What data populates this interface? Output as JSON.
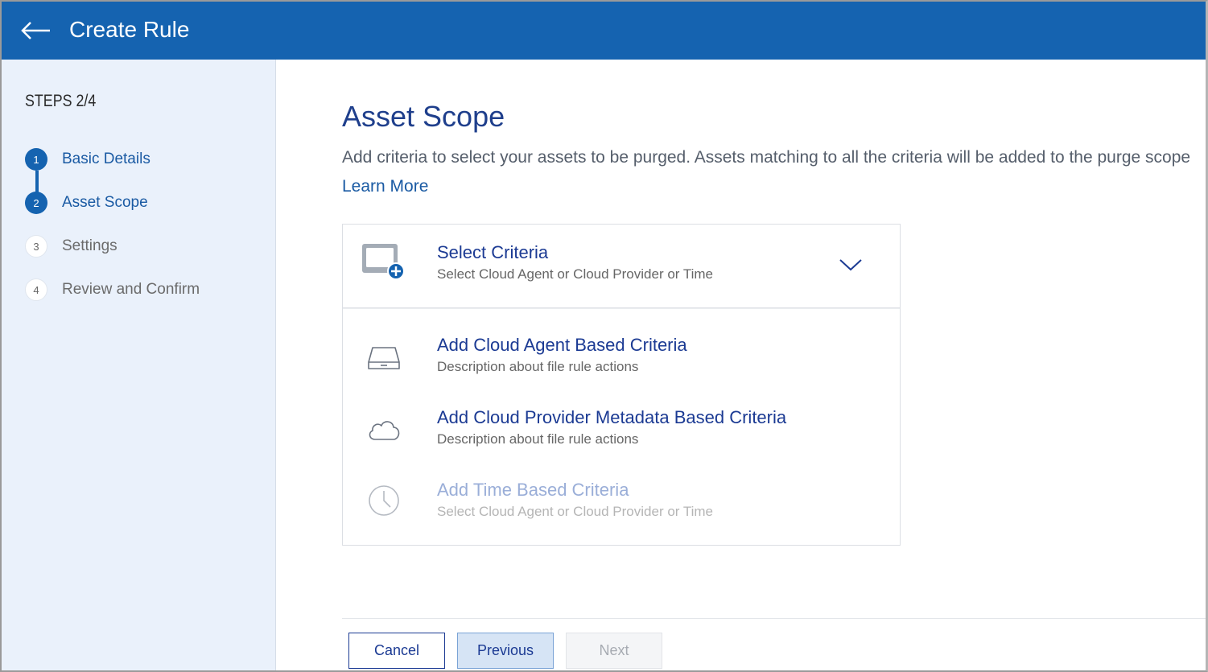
{
  "header": {
    "title": "Create Rule"
  },
  "sidebar": {
    "steps_label": "STEPS 2/4",
    "items": [
      {
        "number": "1",
        "label": "Basic Details",
        "state": "done"
      },
      {
        "number": "2",
        "label": "Asset Scope",
        "state": "active"
      },
      {
        "number": "3",
        "label": "Settings",
        "state": "pending"
      },
      {
        "number": "4",
        "label": "Review and Confirm",
        "state": "pending"
      }
    ]
  },
  "main": {
    "title": "Asset Scope",
    "description": "Add criteria to select your assets to be purged. Assets matching to all the criteria will be added to the purge scope",
    "learn_more": "Learn More",
    "select": {
      "title": "Select Criteria",
      "subtitle": "Select Cloud Agent or Cloud Provider or Time"
    },
    "options": [
      {
        "title": "Add Cloud Agent Based Criteria",
        "description": "Description about file rule actions",
        "icon": "drive-icon",
        "enabled": true
      },
      {
        "title": "Add Cloud Provider Metadata Based Criteria",
        "description": "Description about file rule actions",
        "icon": "cloud-icon",
        "enabled": true
      },
      {
        "title": "Add Time Based Criteria",
        "description": "Select Cloud Agent or Cloud Provider or Time",
        "icon": "clock-icon",
        "enabled": false
      }
    ]
  },
  "footer": {
    "cancel_label": "Cancel",
    "previous_label": "Previous",
    "next_label": "Next"
  },
  "colors": {
    "header_bg": "#1563b0",
    "sidebar_bg": "#eaf1fb",
    "accent": "#1b3a93"
  }
}
